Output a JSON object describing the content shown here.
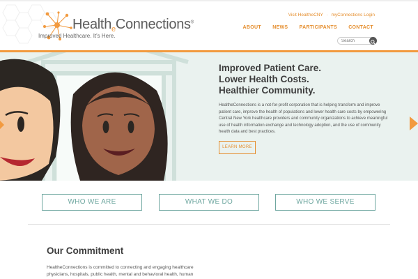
{
  "header": {
    "logo_text_pre": "Health",
    "logo_text_e": "e",
    "logo_text_post": "Connections",
    "logo_trademark": "®",
    "tagline": "Improved Healthcare. It's Here.",
    "util_links": [
      "Visit HealtheCNY",
      "myConnections Login"
    ],
    "util_separator": "·",
    "nav": [
      "ABOUT",
      "NEWS",
      "PARTICIPANTS",
      "CONTACT"
    ],
    "search": {
      "placeholder": "Search"
    }
  },
  "hero": {
    "headline": [
      "Improved Patient Care.",
      "Lower Health Costs.",
      "Healthier Community."
    ],
    "body": "HealtheConnections is a not-for-profit corporation that is helping transform and improve patient care, improve the health of populations and lower health care costs by empowering Central New York healthcare providers and community organizations to achieve meaningful use of health information exchange and technology adoption, and the use of community health data and best practices.",
    "cta_label": "LEARN MORE"
  },
  "sections": [
    {
      "label": "WHO WE ARE"
    },
    {
      "label": "WHAT WE DO"
    },
    {
      "label": "WHO WE SERVE"
    }
  ],
  "commitment": {
    "title": "Our Commitment",
    "body": "HealtheConnections is committed to connecting and engaging healthcare physicians, hospitals, public health, mental and behavioral health, human"
  },
  "colors": {
    "accent": "#f29a3f",
    "teal": "#6fa7a0",
    "hero_bg": "#eaf2ef"
  }
}
